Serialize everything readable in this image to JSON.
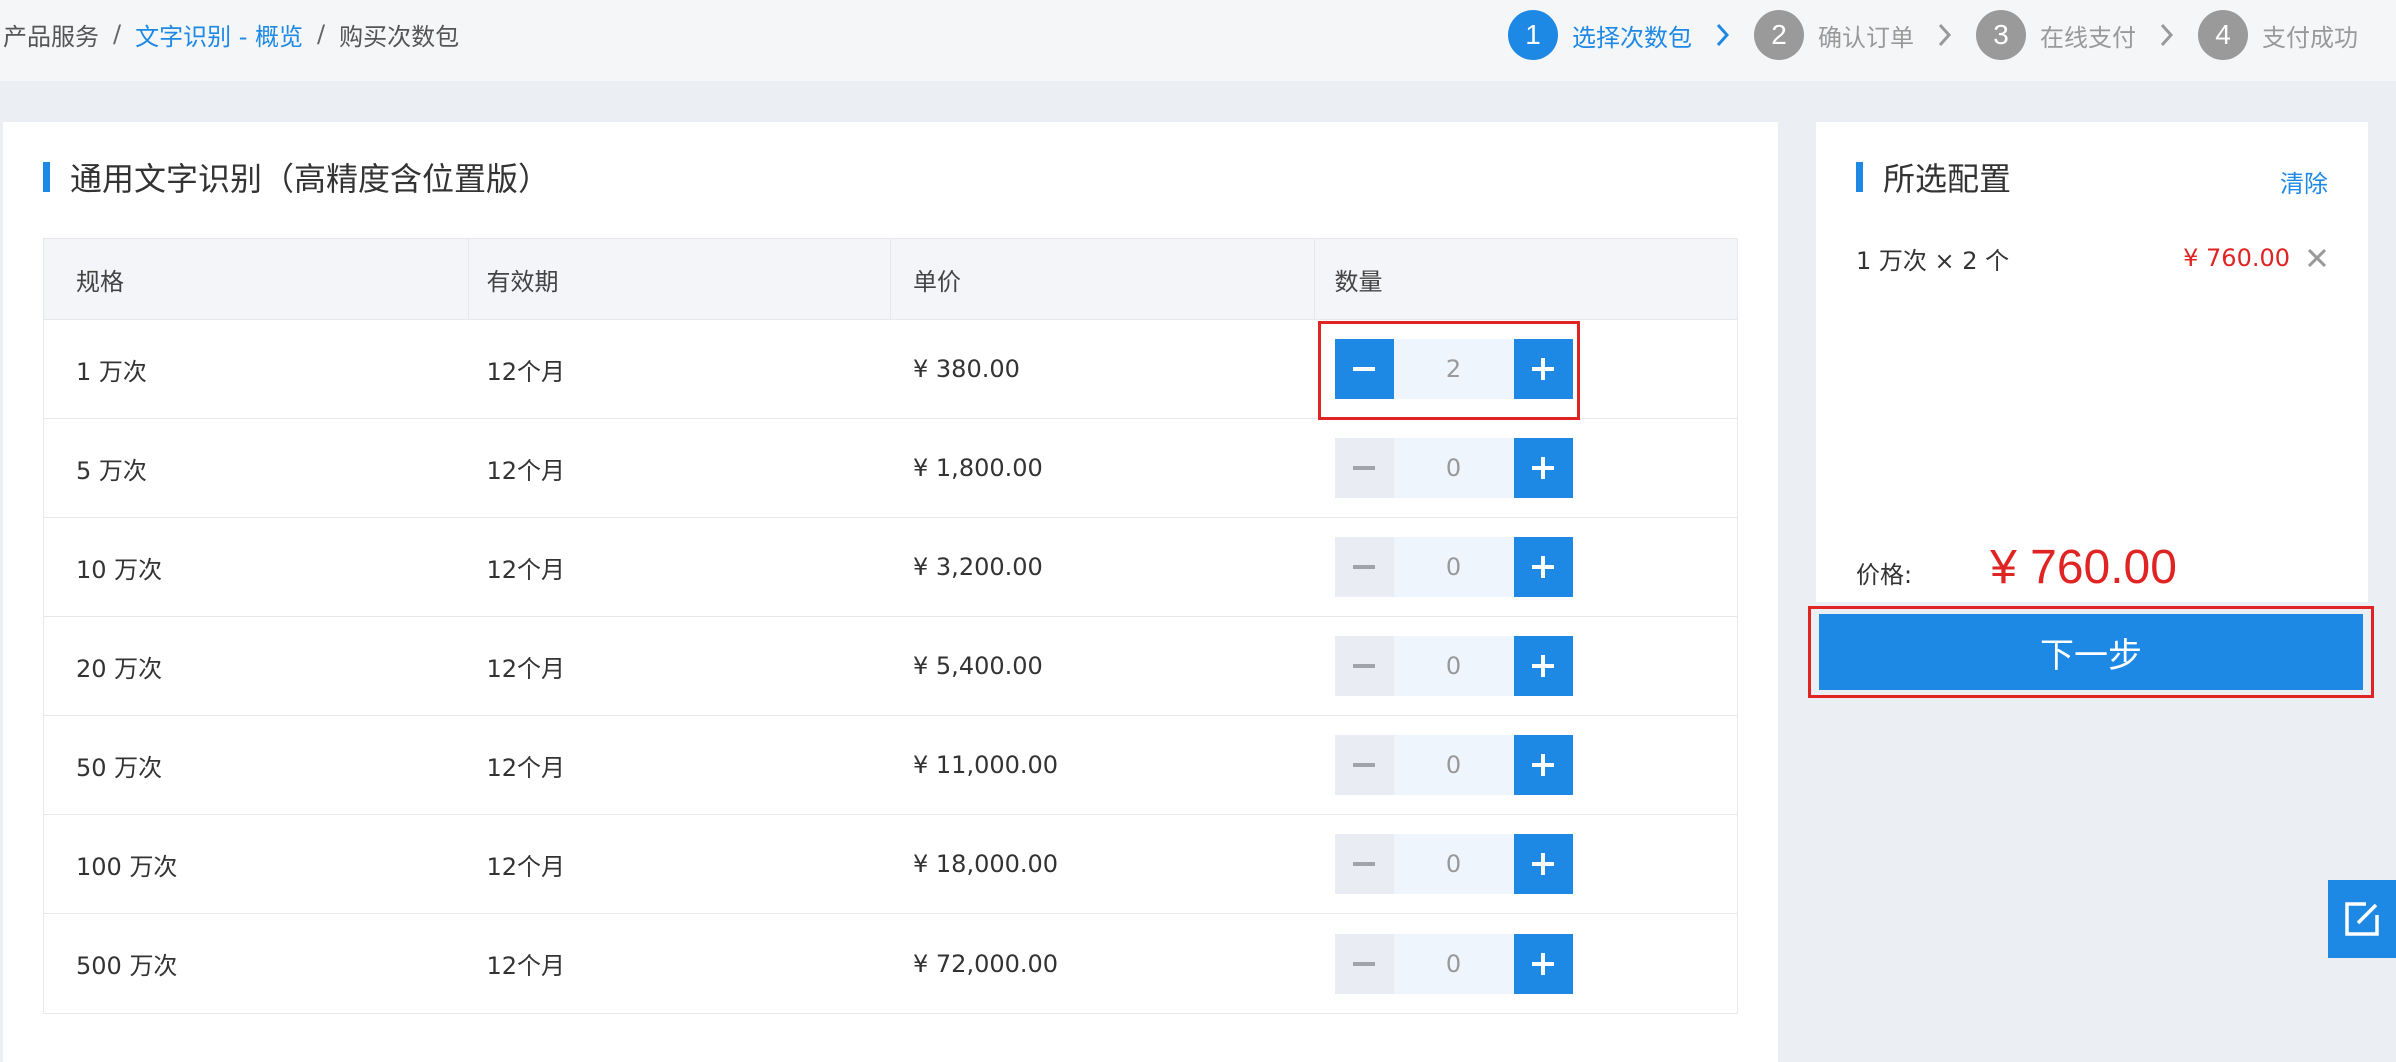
{
  "breadcrumb": {
    "root": "产品服务",
    "sep": "/",
    "link": "文字识别 - 概览",
    "current": "购买次数包"
  },
  "steps": [
    {
      "num": "1",
      "label": "选择次数包",
      "active": true
    },
    {
      "num": "2",
      "label": "确认订单",
      "active": false
    },
    {
      "num": "3",
      "label": "在线支付",
      "active": false
    },
    {
      "num": "4",
      "label": "支付成功",
      "active": false
    }
  ],
  "main": {
    "title": "通用文字识别（高精度含位置版）",
    "columns": [
      "规格",
      "有效期",
      "单价",
      "数量"
    ],
    "rows": [
      {
        "spec": "1 万次",
        "period": "12个月",
        "price": "¥ 380.00",
        "qty": "2"
      },
      {
        "spec": "5 万次",
        "period": "12个月",
        "price": "¥ 1,800.00",
        "qty": "0"
      },
      {
        "spec": "10 万次",
        "period": "12个月",
        "price": "¥ 3,200.00",
        "qty": "0"
      },
      {
        "spec": "20 万次",
        "period": "12个月",
        "price": "¥ 5,400.00",
        "qty": "0"
      },
      {
        "spec": "50 万次",
        "period": "12个月",
        "price": "¥ 11,000.00",
        "qty": "0"
      },
      {
        "spec": "100 万次",
        "period": "12个月",
        "price": "¥ 18,000.00",
        "qty": "0"
      },
      {
        "spec": "500 万次",
        "period": "12个月",
        "price": "¥ 72,000.00",
        "qty": "0"
      }
    ]
  },
  "side": {
    "title": "所选配置",
    "clear": "清除",
    "selected": {
      "desc": "1 万次 × 2 个",
      "price": "¥ 760.00"
    },
    "total_label": "价格:",
    "total_amount": "¥ 760.00",
    "next": "下一步"
  },
  "colors": {
    "accent": "#1e88e5",
    "price_red": "#e02424"
  },
  "icons": [
    "chevron-right-icon",
    "minus-icon",
    "plus-icon",
    "close-icon",
    "edit-icon"
  ]
}
